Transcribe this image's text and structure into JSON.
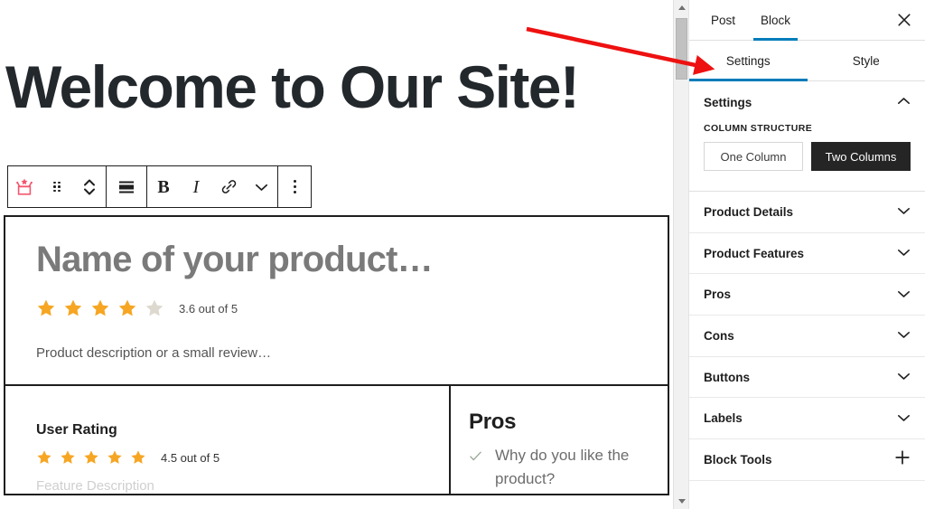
{
  "editor": {
    "page_title": "Welcome to Our Site!",
    "toolbar": {
      "block_type_icon": "product-review-crown-icon",
      "drag_handle_icon": "drag-handle-icon",
      "move_up_down_icon": "move-up-down-chevrons-icon",
      "align_icon": "align-center-icon",
      "bold_label": "B",
      "italic_label": "I",
      "link_icon": "link-icon",
      "more_formats_icon": "chevron-down-icon",
      "options_icon": "more-options-vertical-dots-icon"
    },
    "product_block": {
      "product_name": "Name of your product…",
      "rating_value": 3.6,
      "rating_max": 5,
      "rating_text": "3.6 out of 5",
      "stars_filled": 4,
      "stars_total": 5,
      "description": "Product description or a small review…",
      "left_column": {
        "heading": "User Rating",
        "rating_value": 4.5,
        "rating_text": "4.5 out of 5",
        "stars_filled": 5,
        "stars_total": 5,
        "feature_description": "Feature Description"
      },
      "right_column": {
        "heading": "Pros",
        "items": [
          {
            "check_icon": "check-icon",
            "text": "Why do you like the product?"
          }
        ]
      }
    }
  },
  "sidebar": {
    "scrollbar": {
      "up_arrow_icon": "scroll-up-arrow-icon",
      "down_arrow_icon": "scroll-down-arrow-icon",
      "thumb": "scrollbar-thumb"
    },
    "panel_tabs": [
      {
        "label": "Post",
        "active": false
      },
      {
        "label": "Block",
        "active": true
      }
    ],
    "close_icon": "close-icon",
    "sub_tabs": [
      {
        "label": "Settings",
        "active": true
      },
      {
        "label": "Style",
        "active": false
      }
    ],
    "settings_section": {
      "title": "Settings",
      "toggle_icon": "chevron-up-icon",
      "column_structure_label": "COLUMN STRUCTURE",
      "options": [
        {
          "label": "One Column",
          "selected": false
        },
        {
          "label": "Two Columns",
          "selected": true
        }
      ]
    },
    "accordions": [
      {
        "label": "Product Details",
        "icon": "chevron-down-icon"
      },
      {
        "label": "Product Features",
        "icon": "chevron-down-icon"
      },
      {
        "label": "Pros",
        "icon": "chevron-down-icon"
      },
      {
        "label": "Cons",
        "icon": "chevron-down-icon"
      },
      {
        "label": "Buttons",
        "icon": "chevron-down-icon"
      },
      {
        "label": "Labels",
        "icon": "chevron-down-icon"
      },
      {
        "label": "Block Tools",
        "icon": "plus-icon"
      }
    ]
  },
  "annotation": {
    "arrow_icon": "red-pointer-arrow",
    "color": "#ee1111"
  },
  "colors": {
    "accent_blue": "#007cba",
    "star_filled": "#f6a623",
    "star_empty": "#ded9cf",
    "selected_button_bg": "#252525",
    "block_icon_pink": "#f2566e"
  }
}
